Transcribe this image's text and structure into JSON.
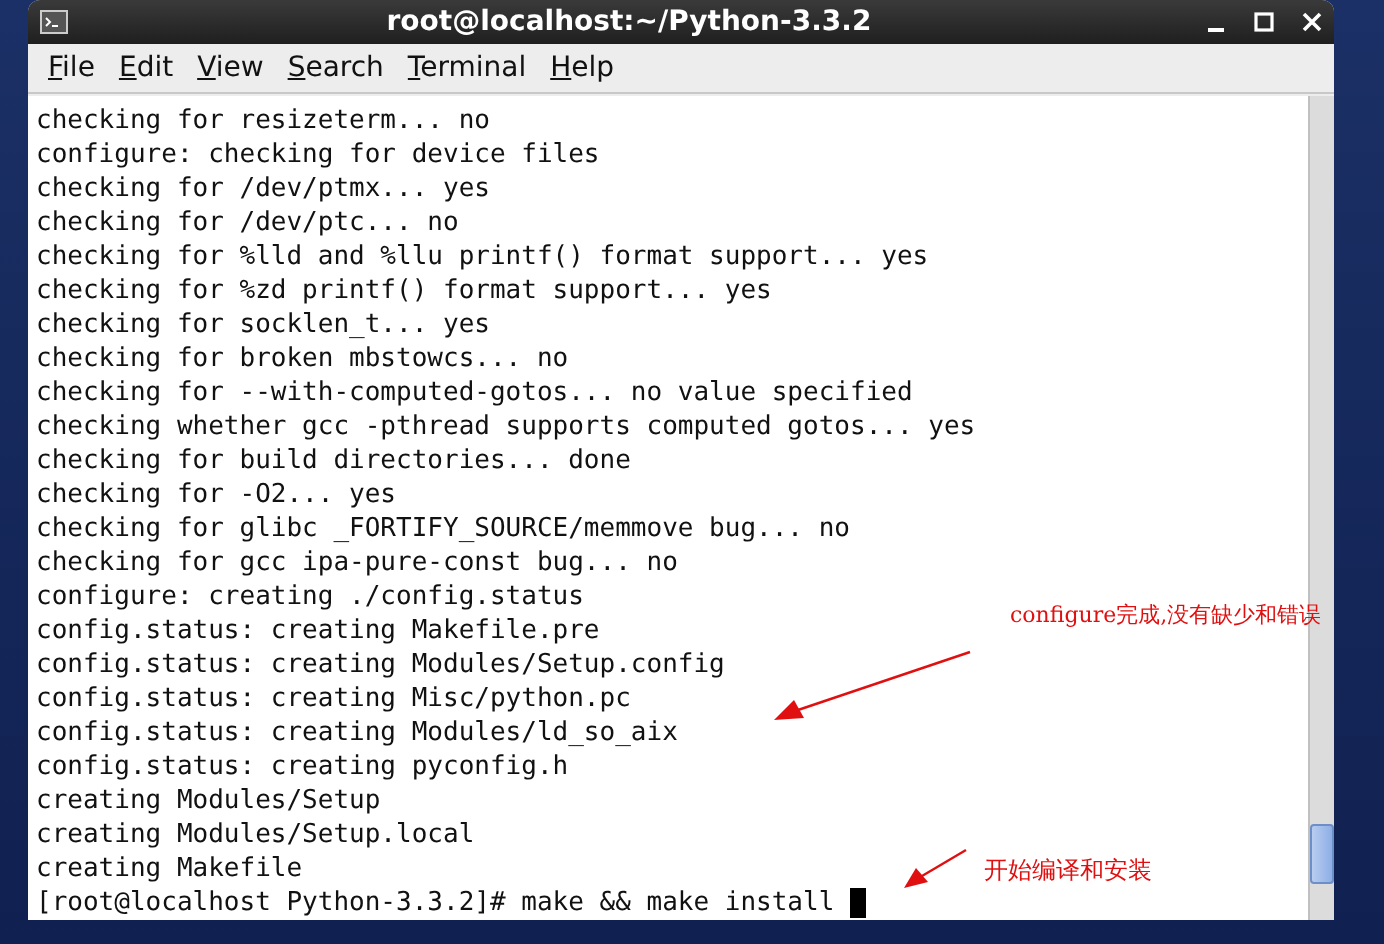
{
  "window": {
    "title": "root@localhost:~/Python-3.3.2"
  },
  "menu": [
    "File",
    "Edit",
    "View",
    "Search",
    "Terminal",
    "Help"
  ],
  "terminal": {
    "lines": [
      "checking for resizeterm... no",
      "configure: checking for device files",
      "checking for /dev/ptmx... yes",
      "checking for /dev/ptc... no",
      "checking for %lld and %llu printf() format support... yes",
      "checking for %zd printf() format support... yes",
      "checking for socklen_t... yes",
      "checking for broken mbstowcs... no",
      "checking for --with-computed-gotos... no value specified",
      "checking whether gcc -pthread supports computed gotos... yes",
      "checking for build directories... done",
      "checking for -O2... yes",
      "checking for glibc _FORTIFY_SOURCE/memmove bug... no",
      "checking for gcc ipa-pure-const bug... no",
      "configure: creating ./config.status",
      "config.status: creating Makefile.pre",
      "config.status: creating Modules/Setup.config",
      "config.status: creating Misc/python.pc",
      "config.status: creating Modules/ld_so_aix",
      "config.status: creating pyconfig.h",
      "creating Modules/Setup",
      "creating Modules/Setup.local",
      "creating Makefile"
    ],
    "prompt": "[root@localhost Python-3.3.2]# make && make install"
  },
  "annotations": [
    "configure完成,没有缺少和错误",
    "开始编译和安装"
  ]
}
